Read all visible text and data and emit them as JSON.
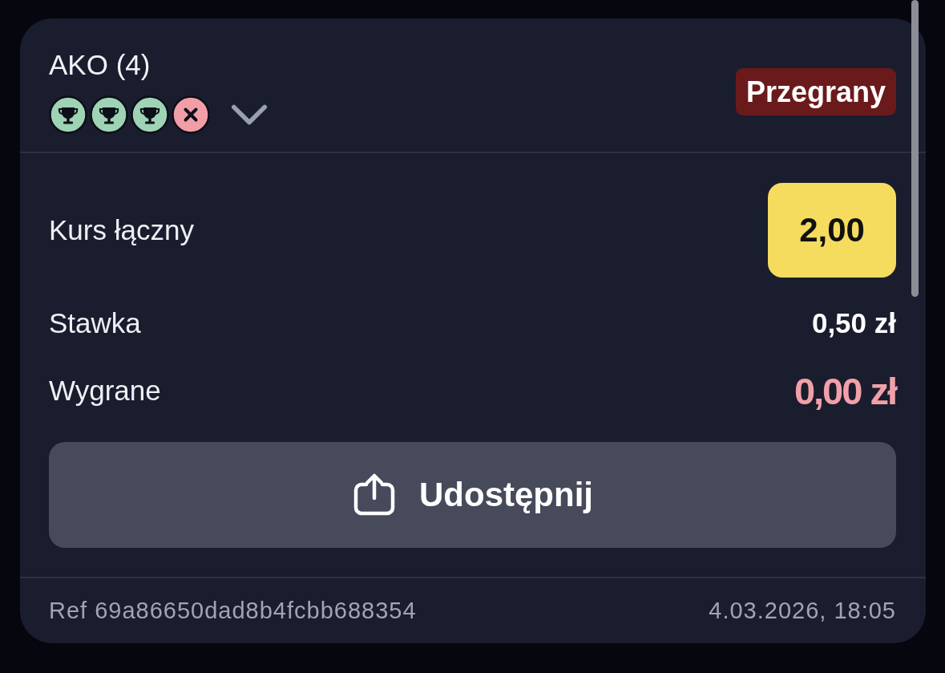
{
  "bet": {
    "title": "AKO (4)",
    "legs": [
      {
        "kind": "won"
      },
      {
        "kind": "won"
      },
      {
        "kind": "won"
      },
      {
        "kind": "lost"
      }
    ],
    "legs_expanded": false,
    "status": "Przegrany"
  },
  "summary": {
    "rows": [
      {
        "kind": "odds",
        "label": "Kurs łączny",
        "value": "2,00"
      },
      {
        "kind": "stake",
        "label": "Stawka",
        "value": "0,50 zł"
      },
      {
        "kind": "payout",
        "label": "Wygrane",
        "value": "0,00 zł"
      }
    ]
  },
  "share_button": {
    "label": "Udostępnij"
  },
  "footer": {
    "ref": "Ref 69a86650dad8b4fcbb688354",
    "date": "4.03.2026, 18:05"
  }
}
